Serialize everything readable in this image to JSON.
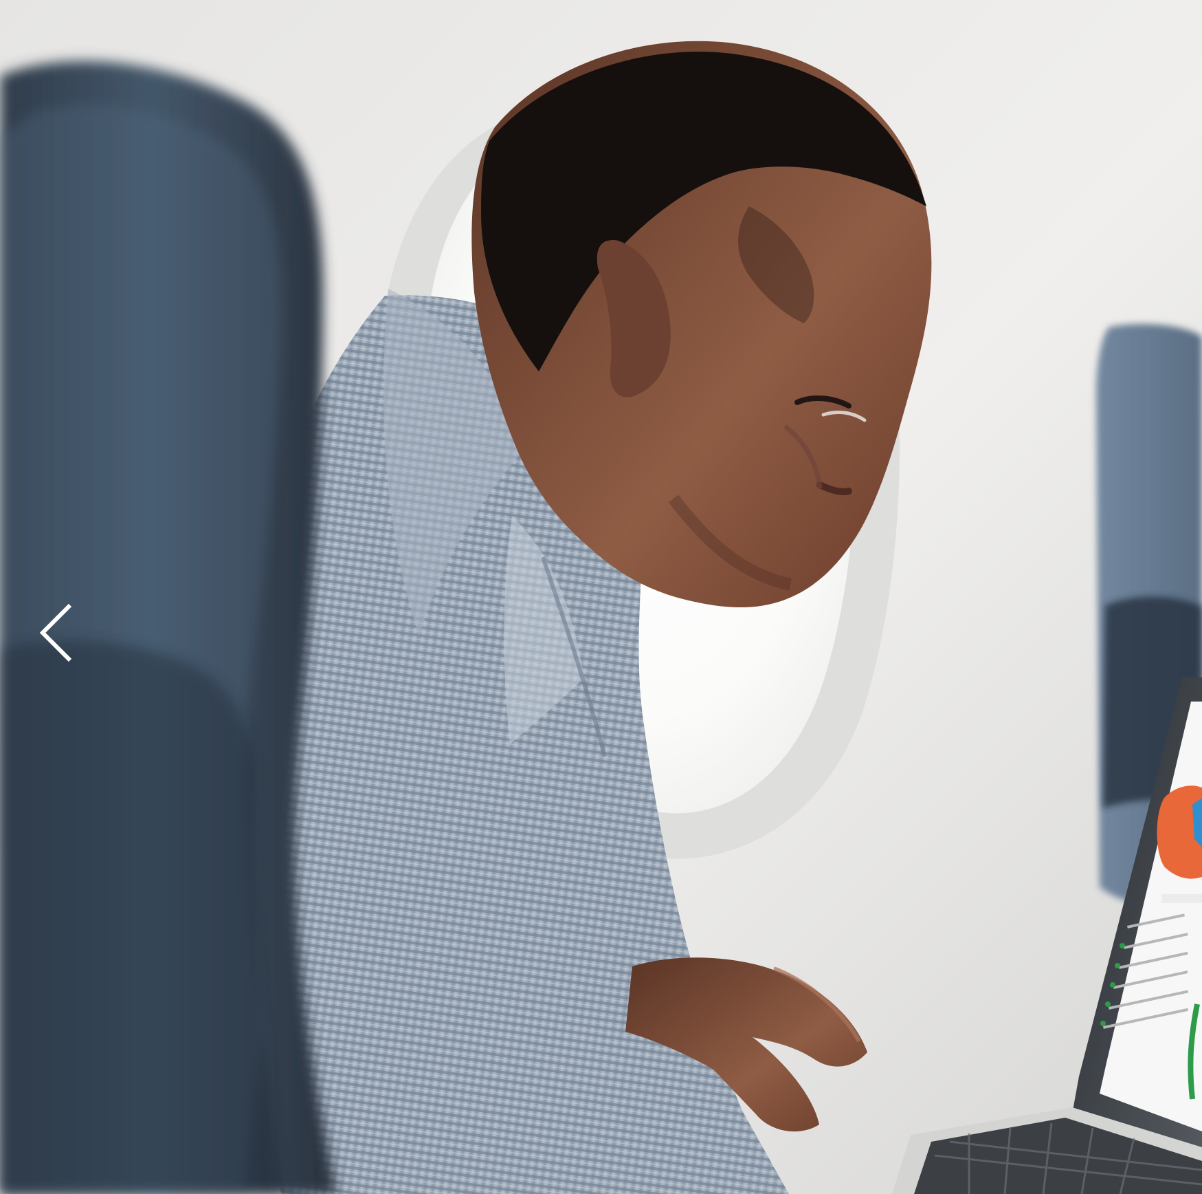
{
  "photo": {
    "description_icon": "photo-scene"
  },
  "carousel": {
    "previous_icon": "chevron-left-icon"
  },
  "colors": {
    "cabin_wall": "#e7e7e5",
    "window_light": "#ffffff",
    "seat_blue": "#3c4b5b",
    "shirt_blue": "#9aa8b6",
    "skin": "#8a5a41",
    "laptop_frame": "#3e4349",
    "screen_white": "#f7f7f7",
    "chart_orange": "#e9683a",
    "chart_blue": "#2f8fd1",
    "accent_green": "#2c9b4a"
  }
}
